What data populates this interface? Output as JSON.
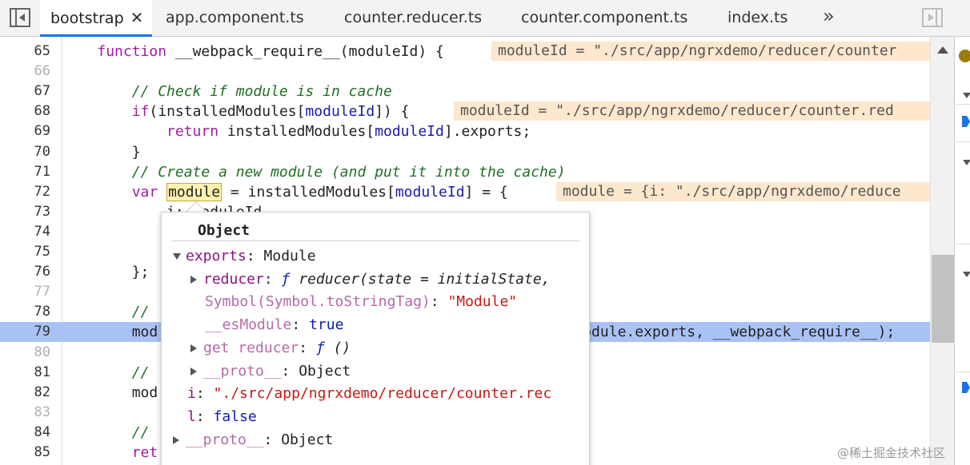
{
  "tabs": [
    {
      "label": "bootstrap",
      "active": true,
      "close": "✕"
    },
    {
      "label": "app.component.ts"
    },
    {
      "label": "counter.reducer.ts"
    },
    {
      "label": "counter.component.ts"
    },
    {
      "label": "index.ts"
    }
  ],
  "tabs_more": "»",
  "lines": [
    {
      "n": "65",
      "parts": [
        [
          "",
          "    "
        ],
        [
          "kw",
          "function"
        ],
        [
          "",
          " __webpack_require__(moduleId) {"
        ]
      ],
      "inline": "moduleId = \"./src/app/ngrxdemo/reducer/counter"
    },
    {
      "n": "66",
      "dim": true,
      "parts": []
    },
    {
      "n": "67",
      "parts": [
        [
          "",
          "        "
        ],
        [
          "cm",
          "// Check if module is in cache"
        ]
      ]
    },
    {
      "n": "68",
      "parts": [
        [
          "",
          "        "
        ],
        [
          "kw",
          "if"
        ],
        [
          "",
          "(installedModules["
        ],
        [
          "mod",
          "moduleId"
        ],
        [
          "",
          "]) {"
        ]
      ],
      "inline": "moduleId = \"./src/app/ngrxdemo/reducer/counter.red"
    },
    {
      "n": "69",
      "parts": [
        [
          "",
          "            "
        ],
        [
          "kw",
          "return"
        ],
        [
          "",
          " installedModules["
        ],
        [
          "mod",
          "moduleId"
        ],
        [
          "",
          "].exports;"
        ]
      ]
    },
    {
      "n": "70",
      "parts": [
        [
          "",
          "        }"
        ]
      ]
    },
    {
      "n": "71",
      "parts": [
        [
          "",
          "        "
        ],
        [
          "cm",
          "// Create a new module (and put it into the cache)"
        ]
      ]
    },
    {
      "n": "72",
      "parts": [
        [
          "",
          "        "
        ],
        [
          "kw",
          "var"
        ],
        [
          "",
          " "
        ],
        [
          "box",
          "module"
        ],
        [
          "",
          " = installedModules["
        ],
        [
          "mod",
          "moduleId"
        ],
        [
          "",
          "] = {"
        ]
      ],
      "inline": "module = {i: \"./src/app/ngrxdemo/reduce"
    },
    {
      "n": "73",
      "parts": [
        [
          "",
          "            i: moduleId,"
        ]
      ]
    },
    {
      "n": "74",
      "parts": []
    },
    {
      "n": "75",
      "parts": []
    },
    {
      "n": "76",
      "parts": [
        [
          "",
          "        };"
        ]
      ]
    },
    {
      "n": "77",
      "dim": true,
      "parts": []
    },
    {
      "n": "78",
      "parts": [
        [
          "",
          "        "
        ],
        [
          "cm",
          "//"
        ]
      ]
    },
    {
      "n": "79",
      "hl": true,
      "parts": [
        [
          "",
          "        mod                                                 odule.exports, __webpack_require__);"
        ]
      ]
    },
    {
      "n": "80",
      "dim": true,
      "parts": []
    },
    {
      "n": "81",
      "parts": [
        [
          "",
          "        "
        ],
        [
          "cm",
          "//"
        ]
      ]
    },
    {
      "n": "82",
      "parts": [
        [
          "",
          "        mod"
        ]
      ]
    },
    {
      "n": "83",
      "dim": true,
      "parts": []
    },
    {
      "n": "84",
      "parts": [
        [
          "",
          "        "
        ],
        [
          "cm",
          "//"
        ]
      ]
    },
    {
      "n": "85",
      "parts": [
        [
          "",
          "        "
        ],
        [
          "kw",
          "ret"
        ]
      ]
    }
  ],
  "popover": {
    "title": "Object",
    "rows": [
      {
        "indent": 0,
        "toggle": "down",
        "parts": [
          [
            "pk",
            "exports"
          ],
          [
            "",
            ": Module"
          ]
        ]
      },
      {
        "indent": 1,
        "toggle": "right",
        "parts": [
          [
            "pk",
            "reducer"
          ],
          [
            "",
            ": "
          ],
          [
            "pfn-f",
            "ƒ"
          ],
          [
            "pfn",
            " reducer(state = initialState, "
          ]
        ]
      },
      {
        "indent": 1,
        "toggle": "none",
        "parts": [
          [
            "pk-dim",
            "Symbol(Symbol.toStringTag)"
          ],
          [
            "",
            ": "
          ],
          [
            "pstr",
            "\"Module\""
          ]
        ]
      },
      {
        "indent": 1,
        "toggle": "none",
        "parts": [
          [
            "pk-dim",
            "__esModule"
          ],
          [
            "",
            ": "
          ],
          [
            "pbool",
            "true"
          ]
        ]
      },
      {
        "indent": 1,
        "toggle": "right",
        "parts": [
          [
            "pk-dim",
            "get reducer"
          ],
          [
            "",
            ": "
          ],
          [
            "pfn-f",
            "ƒ"
          ],
          [
            "pfn",
            " ()"
          ]
        ]
      },
      {
        "indent": 1,
        "toggle": "right",
        "parts": [
          [
            "pk-dim",
            "__proto__"
          ],
          [
            "",
            ": Object"
          ]
        ]
      },
      {
        "indent": 0,
        "toggle": "none",
        "parts": [
          [
            "pk",
            "i"
          ],
          [
            "",
            ": "
          ],
          [
            "pstr",
            "\"./src/app/ngrxdemo/reducer/counter.rec"
          ]
        ]
      },
      {
        "indent": 0,
        "toggle": "none",
        "parts": [
          [
            "pk",
            "l"
          ],
          [
            "",
            ": "
          ],
          [
            "pbool",
            "false"
          ]
        ]
      },
      {
        "indent": 0,
        "toggle": "right",
        "parts": [
          [
            "pk-dim",
            "__proto__"
          ],
          [
            "",
            ": Object"
          ]
        ]
      }
    ]
  },
  "watermark": "@稀土掘金技术社区"
}
